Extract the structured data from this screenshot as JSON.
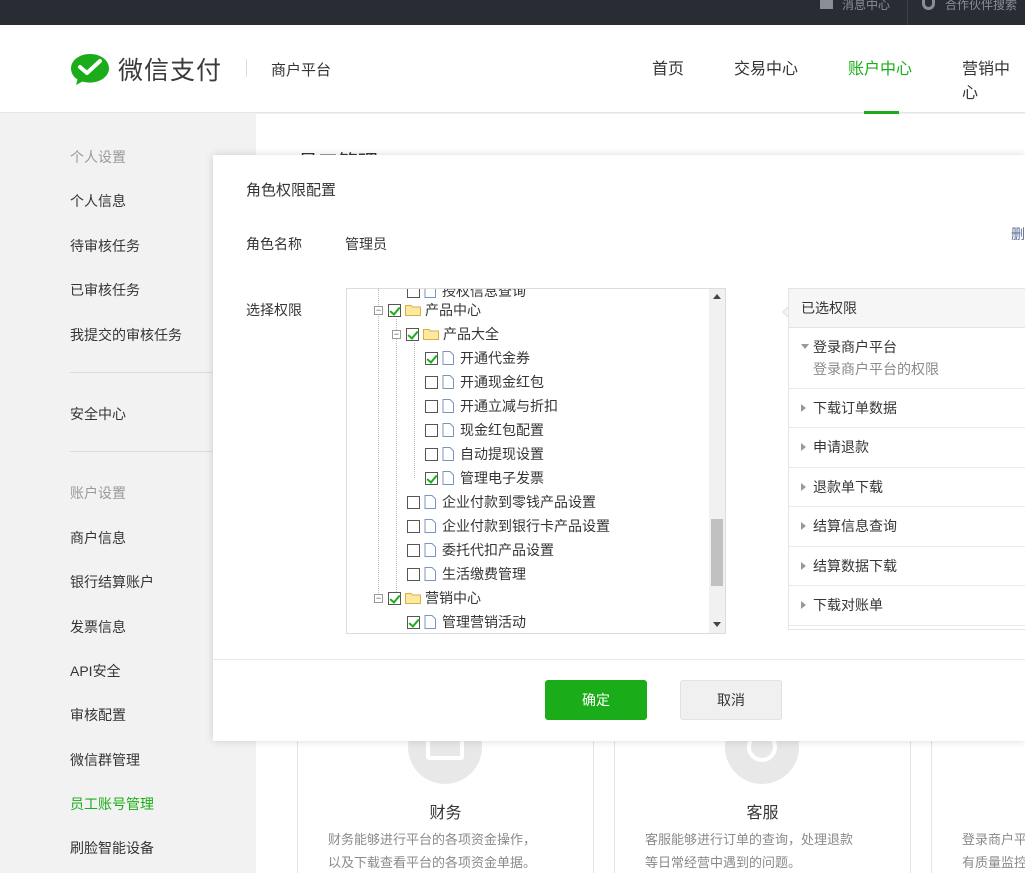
{
  "topbar": {
    "messages": "消息中心",
    "partner_search": "合作伙伴搜索"
  },
  "header": {
    "logo_text": "微信支付",
    "platform": "商户平台",
    "nav": [
      "首页",
      "交易中心",
      "账户中心",
      "营销中心"
    ],
    "active_nav": "账户中心"
  },
  "sidebar": {
    "personal_group": "个人设置",
    "personal_items": [
      "个人信息",
      "待审核任务",
      "已审核任务",
      "我提交的审核任务"
    ],
    "security": "安全中心",
    "account_group": "账户设置",
    "account_items": [
      "商户信息",
      "银行结算账户",
      "发票信息",
      "API安全",
      "审核配置",
      "微信群管理",
      "员工账号管理",
      "刷脸智能设备"
    ],
    "active_item": "员工账号管理"
  },
  "main": {
    "title": "员工管理",
    "cards": [
      {
        "title": "财务",
        "desc1": "财务能够进行平台的各项资金操作，",
        "desc2": "以及下载查看平台的各项资金单据。"
      },
      {
        "title": "客服",
        "desc1": "客服能够进行订单的查询，处理退款",
        "desc2": "等日常经营中遇到的问题。"
      },
      {
        "title": "",
        "desc1": "登录商户平",
        "desc2": "有质量监控"
      }
    ]
  },
  "modal": {
    "title": "角色权限配置",
    "role_name_label": "角色名称",
    "role_name_value": "管理员",
    "delete_link": "删",
    "select_label": "选择权限",
    "tree": [
      {
        "label": "授权信息查询",
        "type": "file",
        "checked": false
      },
      {
        "label": "产品中心",
        "type": "folder",
        "checked": true,
        "expander": "⊟"
      },
      {
        "label": "产品大全",
        "type": "folder",
        "checked": true,
        "expander": "⊟"
      },
      {
        "label": "开通代金券",
        "type": "file",
        "checked": true
      },
      {
        "label": "开通现金红包",
        "type": "file",
        "checked": false
      },
      {
        "label": "开通立减与折扣",
        "type": "file",
        "checked": false
      },
      {
        "label": "现金红包配置",
        "type": "file",
        "checked": false
      },
      {
        "label": "自动提现设置",
        "type": "file",
        "checked": false
      },
      {
        "label": "管理电子发票",
        "type": "file",
        "checked": true
      },
      {
        "label": "企业付款到零钱产品设置",
        "type": "file",
        "checked": false
      },
      {
        "label": "企业付款到银行卡产品设置",
        "type": "file",
        "checked": false
      },
      {
        "label": "委托代扣产品设置",
        "type": "file",
        "checked": false
      },
      {
        "label": "生活缴费管理",
        "type": "file",
        "checked": false
      },
      {
        "label": "营销中心",
        "type": "folder",
        "checked": true,
        "expander": "⊟"
      },
      {
        "label": "管理营销活动",
        "type": "file",
        "checked": true
      }
    ],
    "selected_header": "已选权限",
    "selected": [
      {
        "label": "登录商户平台",
        "desc": "登录商户平台的权限",
        "expanded": true
      },
      {
        "label": "下载订单数据",
        "expanded": false
      },
      {
        "label": "申请退款",
        "expanded": false
      },
      {
        "label": "退款单下载",
        "expanded": false
      },
      {
        "label": "结算信息查询",
        "expanded": false
      },
      {
        "label": "结算数据下载",
        "expanded": false
      },
      {
        "label": "下载对账单",
        "expanded": false
      }
    ],
    "ok": "确定",
    "cancel": "取消"
  },
  "colors": {
    "brand_green": "#1aad19",
    "link_blue": "#576b95",
    "topbar": "#2a2c33"
  }
}
